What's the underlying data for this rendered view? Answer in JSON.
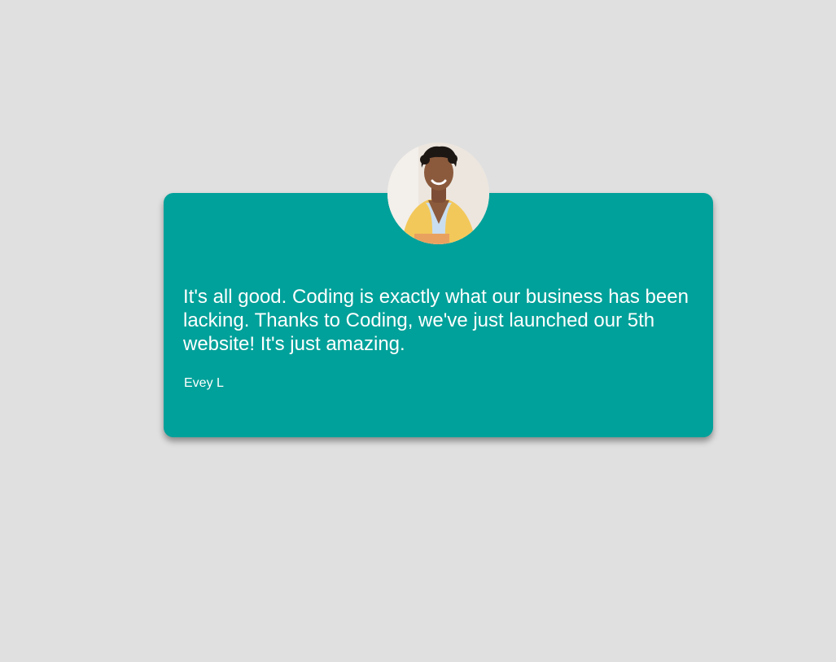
{
  "testimonial": {
    "quote": "It's all good. Coding is exactly what our business has been lacking. Thanks to Coding, we've just launched our 5th website! It's just amazing.",
    "author": "Evey L",
    "avatar_icon": "person-portrait",
    "colors": {
      "page_background": "#e0e0e0",
      "card_background": "#00a19a",
      "text": "#ffffff",
      "avatar_jacket": "#f3c85a",
      "avatar_top": "#c9def0"
    }
  }
}
